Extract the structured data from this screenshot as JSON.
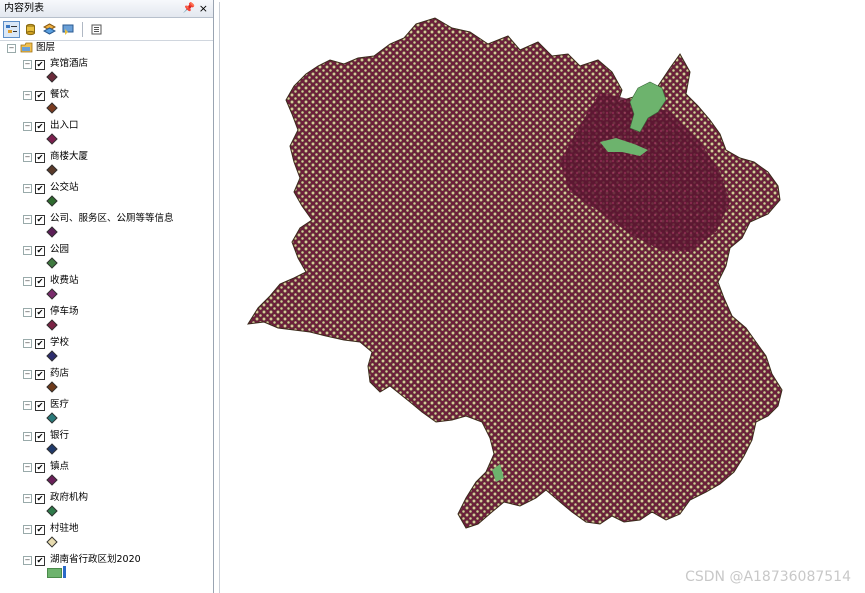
{
  "toc": {
    "title": "内容列表",
    "pin_glyph": "ᚲ",
    "close_glyph": "×",
    "toolbar": [
      "list-by-drawing-order-icon",
      "list-by-source-icon",
      "list-by-visibility-icon",
      "list-by-selection-icon",
      "options-icon"
    ],
    "root": {
      "label": "图层"
    },
    "layers": [
      {
        "label": "宾馆酒店",
        "symbol_color": "#6b2a3a"
      },
      {
        "label": "餐饮",
        "symbol_color": "#7a3b1f"
      },
      {
        "label": "出入口",
        "symbol_color": "#7c1f4f"
      },
      {
        "label": "商楼大厦",
        "symbol_color": "#5a3a2a"
      },
      {
        "label": "公交站",
        "symbol_color": "#2e6b2e"
      },
      {
        "label": "公司、服务区、公厕等等信息",
        "symbol_color": "#5c1e57"
      },
      {
        "label": "公园",
        "symbol_color": "#3f7a3f"
      },
      {
        "label": "收费站",
        "symbol_color": "#7a2b6c"
      },
      {
        "label": "停车场",
        "symbol_color": "#7a2244"
      },
      {
        "label": "学校",
        "symbol_color": "#2c2c6e"
      },
      {
        "label": "药店",
        "symbol_color": "#6e3a1a"
      },
      {
        "label": "医疗",
        "symbol_color": "#2a7a7a"
      },
      {
        "label": "银行",
        "symbol_color": "#1f3a6b"
      },
      {
        "label": "镇点",
        "symbol_color": "#6b1f5a"
      },
      {
        "label": "政府机构",
        "symbol_color": "#2e7a4a"
      },
      {
        "label": "村驻地",
        "symbol_color": "#e8dcb0"
      },
      {
        "label": "湖南省行政区划2020",
        "symbol_color": "#6db36d"
      }
    ]
  },
  "map": {
    "colors": {
      "fill": "#6d1f3c",
      "dots": "#d8c89a",
      "green": "#6db36d",
      "outline": "#3a2a1a"
    }
  },
  "watermark": "CSDN @A18736087514"
}
